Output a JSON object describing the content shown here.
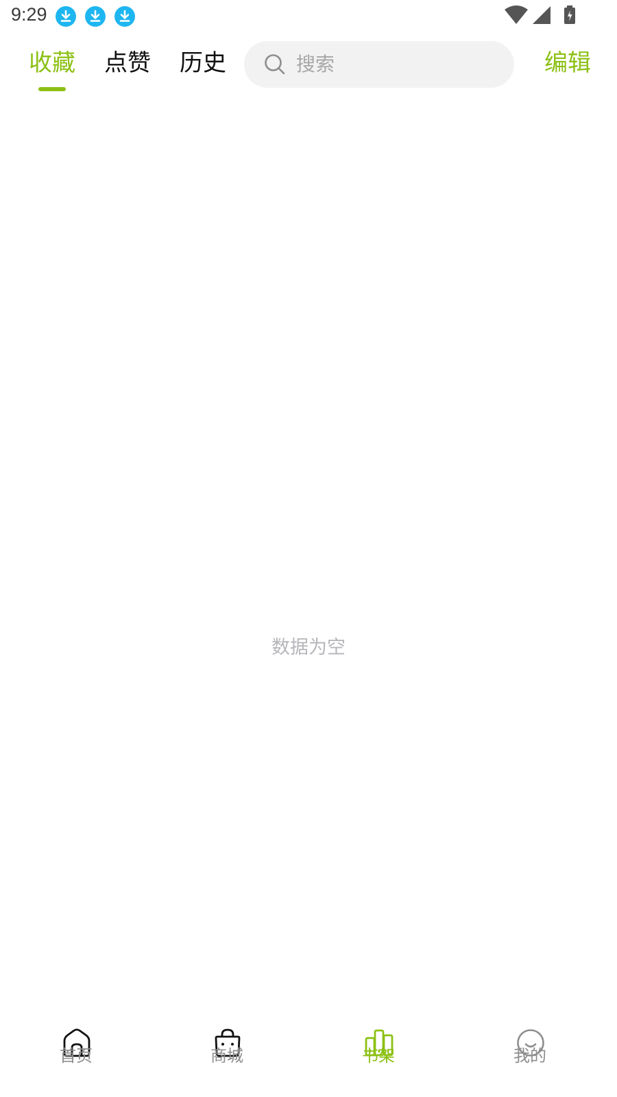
{
  "status_bar": {
    "time": "9:29",
    "notifications": [
      "download-icon",
      "download-icon",
      "download-icon"
    ],
    "notification_color": "#1eb6f0",
    "system_icons": [
      "wifi-icon",
      "signal-icon",
      "battery-charging-icon"
    ]
  },
  "header": {
    "tabs": [
      {
        "label": "收藏",
        "active": true
      },
      {
        "label": "点赞",
        "active": false
      },
      {
        "label": "历史",
        "active": false
      }
    ],
    "search": {
      "placeholder": "搜索",
      "icon": "search-icon"
    },
    "edit_label": "编辑"
  },
  "main": {
    "empty_message": "数据为空"
  },
  "bottom_nav": {
    "items": [
      {
        "label": "首页",
        "icon": "home-icon",
        "active": false
      },
      {
        "label": "商城",
        "icon": "shopping-bag-icon",
        "active": false
      },
      {
        "label": "书架",
        "icon": "bookshelf-icon",
        "active": true
      },
      {
        "label": "我的",
        "icon": "smile-icon",
        "active": false
      }
    ]
  },
  "colors": {
    "accent": "#8cc014",
    "text_primary": "#111111",
    "text_muted": "#8e8e8e",
    "search_bg": "#f2f2f2"
  }
}
